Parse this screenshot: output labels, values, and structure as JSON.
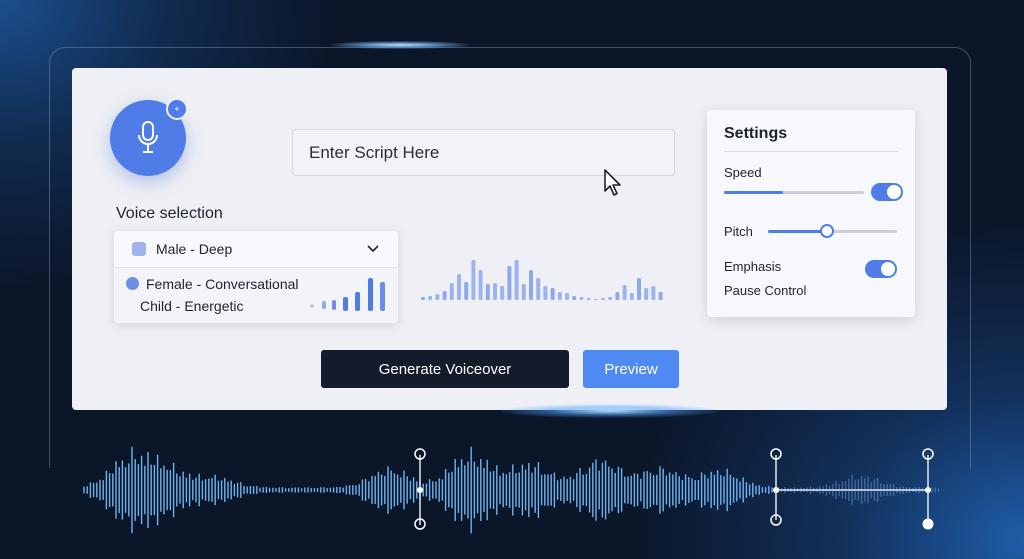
{
  "header": {
    "badge": "+",
    "script_placeholder": "Enter Script Here"
  },
  "voice": {
    "title": "Voice selection",
    "selected": "Male - Deep",
    "options": [
      "Female - Conversational",
      "Child - Energetic"
    ]
  },
  "settings": {
    "title": "Settings",
    "speed": {
      "label": "Speed",
      "value": 0.42,
      "toggle_on": true
    },
    "pitch": {
      "label": "Pitch",
      "value": 0.46
    },
    "emphasis": {
      "label": "Emphasis",
      "on": true
    },
    "pause": {
      "label": "Pause Control"
    }
  },
  "actions": {
    "generate": "Generate Voiceover",
    "preview": "Preview"
  },
  "colors": {
    "accent": "#4f7ce6",
    "dark_button": "#141b2b",
    "preview_button": "#4f8af3",
    "background": "#0b1629",
    "panel": "#eef0f5"
  },
  "icons": [
    "microphone-icon",
    "chevron-down-icon",
    "mouse-pointer-icon"
  ]
}
